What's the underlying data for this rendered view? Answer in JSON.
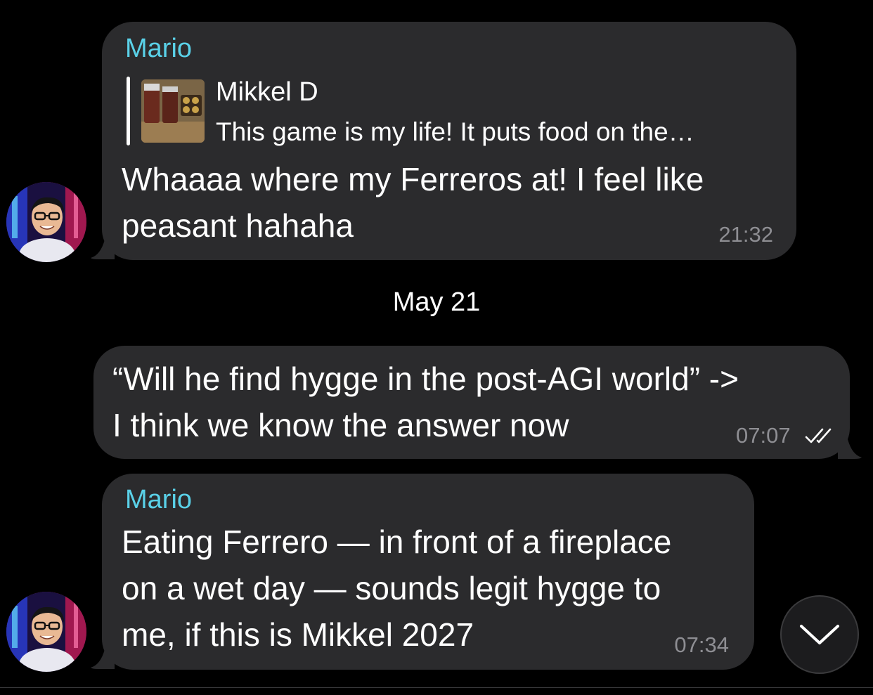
{
  "chat": {
    "messages": [
      {
        "direction": "incoming",
        "sender": "Mario",
        "reply": {
          "name": "Mikkel D",
          "text": "This game is my life! It puts food on the…"
        },
        "lines": [
          "Whaaaa where my Ferreros at! I feel like",
          "peasant hahaha"
        ],
        "time": "21:32"
      },
      {
        "direction": "outgoing",
        "lines": [
          "“Will he find hygge in the post-AGI world” ->",
          "I think we know the answer now"
        ],
        "time": "07:07",
        "status_icon": "double-check-icon"
      },
      {
        "direction": "incoming",
        "sender": "Mario",
        "lines": [
          "Eating Ferrero — in front of a fireplace",
          "on a wet day — sounds legit hygge to",
          "me, if this is Mikkel 2027"
        ],
        "time": "07:34"
      }
    ],
    "date_separator": "May 21"
  },
  "colors": {
    "background": "#000000",
    "bubble": "#2b2b2d",
    "sender_name": "#5ad1e8",
    "timestamp": "#8e8e93"
  },
  "icons": {
    "scroll_down": "chevron-down-icon",
    "avatar": "avatar"
  }
}
